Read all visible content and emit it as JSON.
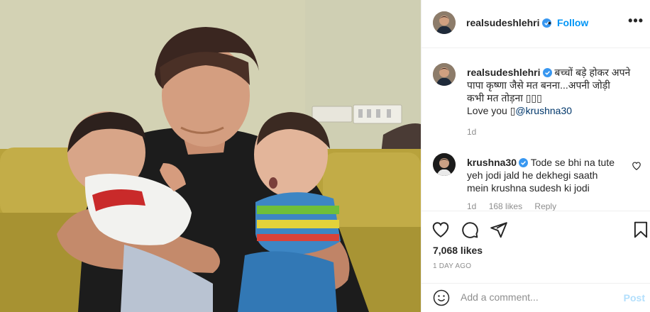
{
  "post": {
    "author": "realsudeshlehri",
    "verified": true,
    "follow_label": "Follow",
    "separator": "•",
    "more_label": "•••"
  },
  "caption": {
    "author": "realsudeshlehri",
    "text_line1": "बच्चों बड़े होकर अपने",
    "text_line2": "पापा कृष्णा जैसे मत बनना...अपनी जोड़ी",
    "text_line3": "कभी मत तोड़ना ▯▯▯",
    "text_line4_prefix": "Love you ▯",
    "mention": "@krushna30",
    "age": "1d"
  },
  "comments": [
    {
      "author": "krushna30",
      "verified": true,
      "line1": "Tode se bhi na tute",
      "line2": "yeh jodi jald he dekhegi saath",
      "line3": "mein krushna sudesh ki jodi",
      "age": "1d",
      "likes": "168 likes",
      "reply_label": "Reply"
    }
  ],
  "actions": {
    "icons": [
      "heart-icon",
      "comment-icon",
      "share-icon",
      "bookmark-icon"
    ],
    "likes": "7,068 likes",
    "timestamp": "1 DAY AGO"
  },
  "add_comment": {
    "placeholder": "Add a comment...",
    "post_label": "Post"
  },
  "colors": {
    "accent": "#0095f6",
    "post_disabled": "#b2dffc",
    "muted": "#8e8e8e",
    "text": "#262626"
  }
}
